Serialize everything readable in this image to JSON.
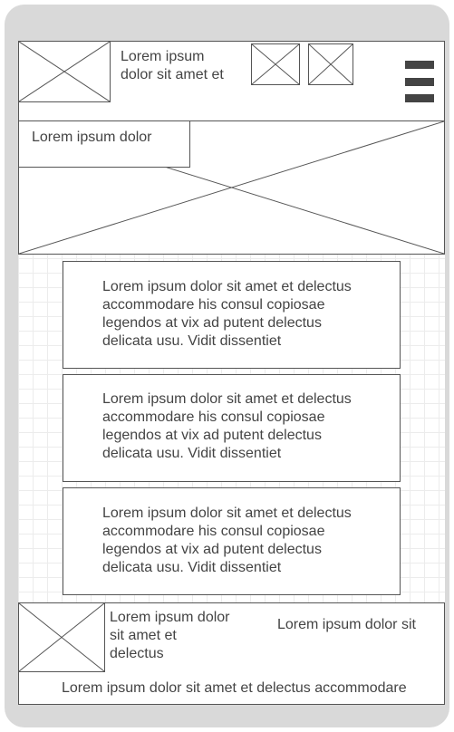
{
  "header": {
    "title": "Lorem ipsum dolor sit amet et",
    "menu_icon": "hamburger-icon",
    "logo_icon": "image-placeholder-icon",
    "action_icons": [
      "image-placeholder-icon",
      "image-placeholder-icon"
    ]
  },
  "hero": {
    "caption": "Lorem ipsum dolor",
    "image_icon": "image-placeholder-icon"
  },
  "cards": [
    {
      "text": "Lorem ipsum dolor sit amet et delectus accommodare his consul copiosae legendos at vix ad putent delectus delicata usu. Vidit dissentiet"
    },
    {
      "text": "Lorem ipsum dolor sit amet et delectus accommodare his consul copiosae legendos at vix ad putent delectus delicata usu. Vidit dissentiet"
    },
    {
      "text": "Lorem ipsum dolor sit amet et delectus accommodare his consul copiosae legendos at vix ad putent delectus delicata usu. Vidit dissentiet"
    }
  ],
  "footer": {
    "thumb_icon": "image-placeholder-icon",
    "thumb_caption": "Lorem ipsum dolor sit amet et delectus",
    "side_text": "Lorem ipsum dolor sit",
    "bottom_text": "Lorem ipsum dolor sit amet et delectus accommodare"
  },
  "colors": {
    "device": "#d9d9d9",
    "border": "#555555",
    "text": "#444444",
    "grid": "#ececec"
  }
}
